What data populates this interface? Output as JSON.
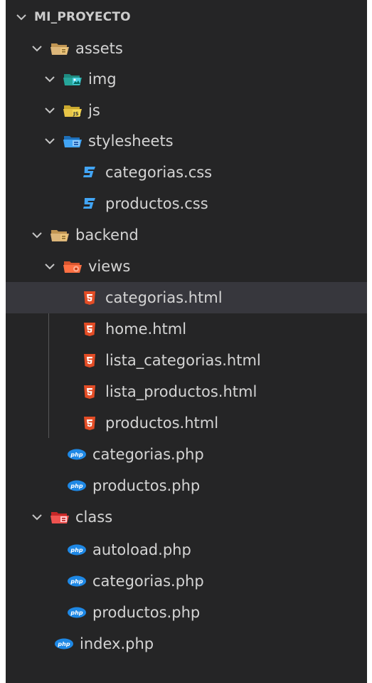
{
  "explorer": {
    "root": {
      "label": "MI_PROYECTO",
      "icon": "chevron-down-icon"
    },
    "items": [
      {
        "label": "assets",
        "icon": "folder-open-icon",
        "color": "#dcb67a"
      },
      {
        "label": "img",
        "icon": "folder-images-icon",
        "color": "#26a69a"
      },
      {
        "label": "js",
        "icon": "folder-js-icon",
        "color": "#e8c547"
      },
      {
        "label": "stylesheets",
        "icon": "folder-css-icon",
        "color": "#42a5f5"
      },
      {
        "label": "categorias.css",
        "icon": "css-file-icon",
        "color": "#42a5f5"
      },
      {
        "label": "productos.css",
        "icon": "css-file-icon",
        "color": "#42a5f5"
      },
      {
        "label": "backend",
        "icon": "folder-open-icon",
        "color": "#dcb67a"
      },
      {
        "label": "views",
        "icon": "folder-views-icon",
        "color": "#ff7043"
      },
      {
        "label": "categorias.html",
        "icon": "html-file-icon",
        "color": "#e44d26"
      },
      {
        "label": "home.html",
        "icon": "html-file-icon",
        "color": "#e44d26"
      },
      {
        "label": "lista_categorias.html",
        "icon": "html-file-icon",
        "color": "#e44d26"
      },
      {
        "label": "lista_productos.html",
        "icon": "html-file-icon",
        "color": "#e44d26"
      },
      {
        "label": "productos.html",
        "icon": "html-file-icon",
        "color": "#e44d26"
      },
      {
        "label": "categorias.php",
        "icon": "php-file-icon",
        "color": "#1e88e5"
      },
      {
        "label": "productos.php",
        "icon": "php-file-icon",
        "color": "#1e88e5"
      },
      {
        "label": "class",
        "icon": "folder-class-icon",
        "color": "#ef5350"
      },
      {
        "label": "autoload.php",
        "icon": "php-file-icon",
        "color": "#1e88e5"
      },
      {
        "label": "categorias.php",
        "icon": "php-file-icon",
        "color": "#1e88e5"
      },
      {
        "label": "productos.php",
        "icon": "php-file-icon",
        "color": "#1e88e5"
      },
      {
        "label": "index.php",
        "icon": "php-file-icon",
        "color": "#1e88e5"
      }
    ],
    "selected_label": "categorias.html"
  }
}
